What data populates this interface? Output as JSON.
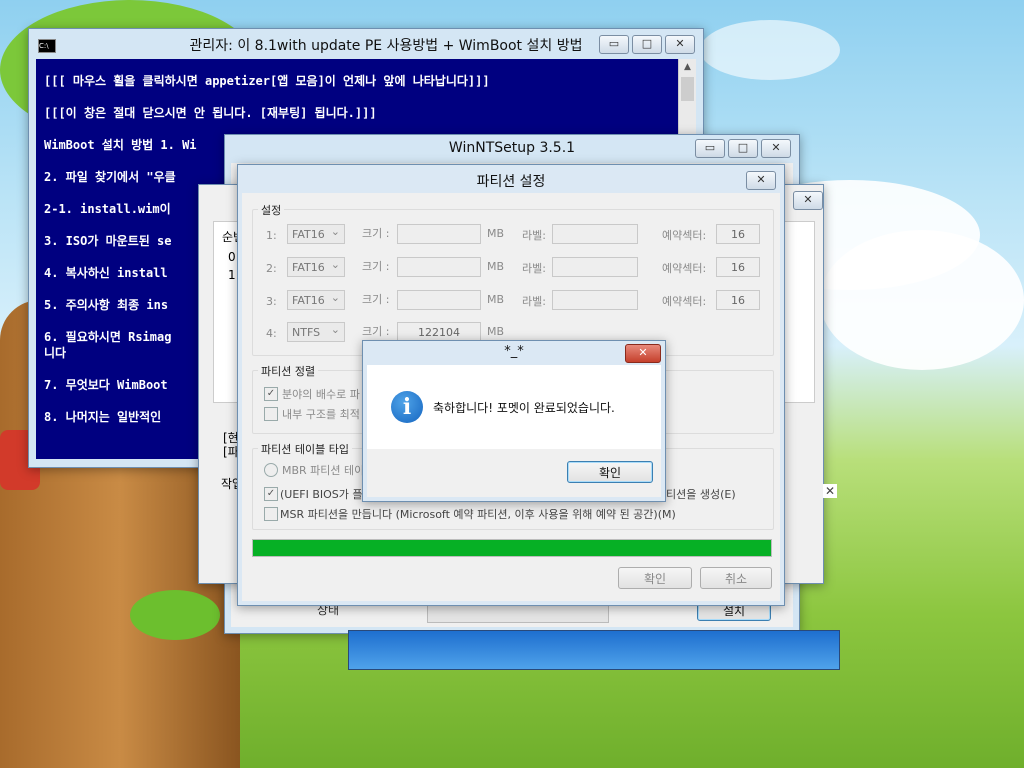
{
  "console": {
    "title": "관리자:  이 8.1with update PE 사용방법 + WimBoot 설치 방법",
    "icon": "cmd-icon",
    "lines": [
      "[[[ 마우스 휠을 클릭하시면 appetizer[앱 모음]이 언제나 앞에 나타납니다]]]",
      "[[[이 창은 절대 닫으시면 안 됩니다. [재부팅] 됩니다.]]]",
      "WimBoot 설치 방법 1. Wi",
      "2. 파일 찾기에서 \"우클",
      "2-1. install.wim이",
      "3. ISO가 마운트된 se",
      "4. 복사하신 install",
      "5. 주의사항 최종 ins",
      "6. 필요하시면 Rsimag",
      "니다",
      "7. 무엇보다 WimBoot",
      "8. 나머지는 일반적인"
    ]
  },
  "winnt": {
    "title": "WinNTSetup 3.5.1",
    "list_header": "순번",
    "list_rows": [
      "0",
      "1"
    ],
    "bracket_a": "[현",
    "bracket_b": "[파",
    "job_label": "작업",
    "status_label": "상태",
    "install_button": "설치"
  },
  "partition": {
    "title": "파티션 설정",
    "settings_label": "설정",
    "rows": [
      {
        "num": "1:",
        "fs": "FAT16",
        "size_label": "크기 :",
        "size": "",
        "unit": "MB",
        "label_label": "라벨:",
        "reserve_label": "예약섹터:",
        "reserve": "16"
      },
      {
        "num": "2:",
        "fs": "FAT16",
        "size_label": "크기 :",
        "size": "",
        "unit": "MB",
        "label_label": "라벨:",
        "reserve_label": "예약섹터:",
        "reserve": "16"
      },
      {
        "num": "3:",
        "fs": "FAT16",
        "size_label": "크기 :",
        "size": "",
        "unit": "MB",
        "label_label": "라벨:",
        "reserve_label": "예약섹터:",
        "reserve": "16"
      },
      {
        "num": "4:",
        "fs": "NTFS",
        "size_label": "크기 :",
        "size": "122104",
        "unit": "MB",
        "label_label": "라벨:",
        "reserve_label": "예약섹터:",
        "reserve": "16"
      }
    ],
    "align_label": "파티션 정렬",
    "align_opt1": "분야의 배수로 파",
    "align_opt2": "내부 구조를 최적",
    "table_type_label": "파티션 테이블 타입",
    "mbr_opt": "MBR 파티션 테이",
    "uefi_opt": "(UEFI BIOS가 플랫",
    "uefi_opt_tail": "티션을 생성(E)",
    "msr_opt": "MSR 파티션을 만듭니다 (Microsoft 예약 파티션, 이후 사용을 위해 예약 된 공간)(M)",
    "progress": 1.0,
    "ok_label": "확인",
    "cancel_label": "취소"
  },
  "msgbox": {
    "title": "*_*",
    "message": "축하합니다! 포멧이 완료되었습니다.",
    "ok_label": "확인",
    "icon": "info-icon"
  },
  "controls": {
    "minimize": "▭",
    "maximize": "□",
    "close": "✕"
  }
}
